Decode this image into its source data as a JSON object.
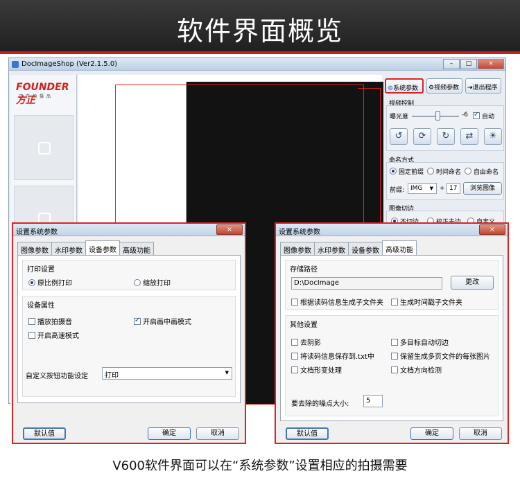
{
  "banner": {
    "title": "软件界面概览"
  },
  "app": {
    "title": "DocImageShop (Ver2.1.5.0)",
    "window_buttons": [
      "–",
      "□",
      "×"
    ],
    "logo": {
      "main": "FOUNDER 方正",
      "sub": "正在拍摄品"
    },
    "top_buttons": {
      "system_params": "系统参数",
      "video_params": "视频参数",
      "exit": "退出程序"
    },
    "video_control": {
      "title": "视频控制",
      "exposure_label": "曝光度",
      "exposure_value": "-6",
      "auto_label": "自动",
      "auto_checked": true,
      "exposure_fraction": 0.55
    },
    "naming": {
      "title": "命名方式",
      "options": [
        "固定前缀",
        "时间命名",
        "自由命名"
      ],
      "selected": 0,
      "prefix_label": "前缀:",
      "prefix_value": "IMG",
      "plus": "+",
      "number_value": "17",
      "browse_button": "浏览图像"
    },
    "crop": {
      "title": "图像切边",
      "options": [
        "不切边",
        "校正去边",
        "自定义"
      ],
      "selected": 0
    }
  },
  "dialog_left": {
    "title": "设置系统参数",
    "close": "×",
    "tabs": [
      "图像参数",
      "水印参数",
      "设备参数",
      "高级功能"
    ],
    "active_tab": 2,
    "print_section": {
      "title": "打印设置",
      "opt_original": "原比例打印",
      "opt_scale": "缩放打印"
    },
    "device_section": {
      "title": "设备属性",
      "chk_sound": "播放拍摄音",
      "chk_pip": "开启画中画模式",
      "chk_highspeed": "开启高速模式"
    },
    "custom_button_label": "自定义按钮功能设定",
    "custom_button_value": "打印",
    "default_button": "默认值",
    "ok_button": "确定",
    "cancel_button": "取消"
  },
  "dialog_right": {
    "title": "设置系统参数",
    "close": "×",
    "tabs": [
      "图像参数",
      "水印参数",
      "设备参数",
      "高级功能"
    ],
    "active_tab": 3,
    "storage_section": {
      "title": "存储路径",
      "path": "D:\\DocImage",
      "change_button": "更改",
      "chk_barcode_folder": "根据读码信息生成子文件夹",
      "chk_time_folder": "生成时间戳子文件夹"
    },
    "other_section": {
      "title": "其他设置",
      "chk_deshadow": "去阴影",
      "chk_multicrop": "多目标自动切边",
      "chk_save_barcode": "将读码信息保存到.txt中",
      "chk_multipage": "保留生成多页文件的每张图片",
      "chk_deform": "文档形变处理",
      "chk_orientation": "文档方向检测",
      "noise_label": "要去除的噪点大小:",
      "noise_value": "5"
    },
    "default_button": "默认值",
    "ok_button": "确定",
    "cancel_button": "取消"
  },
  "caption": "V600软件界面可以在“系统参数”设置相应的拍摄需要"
}
